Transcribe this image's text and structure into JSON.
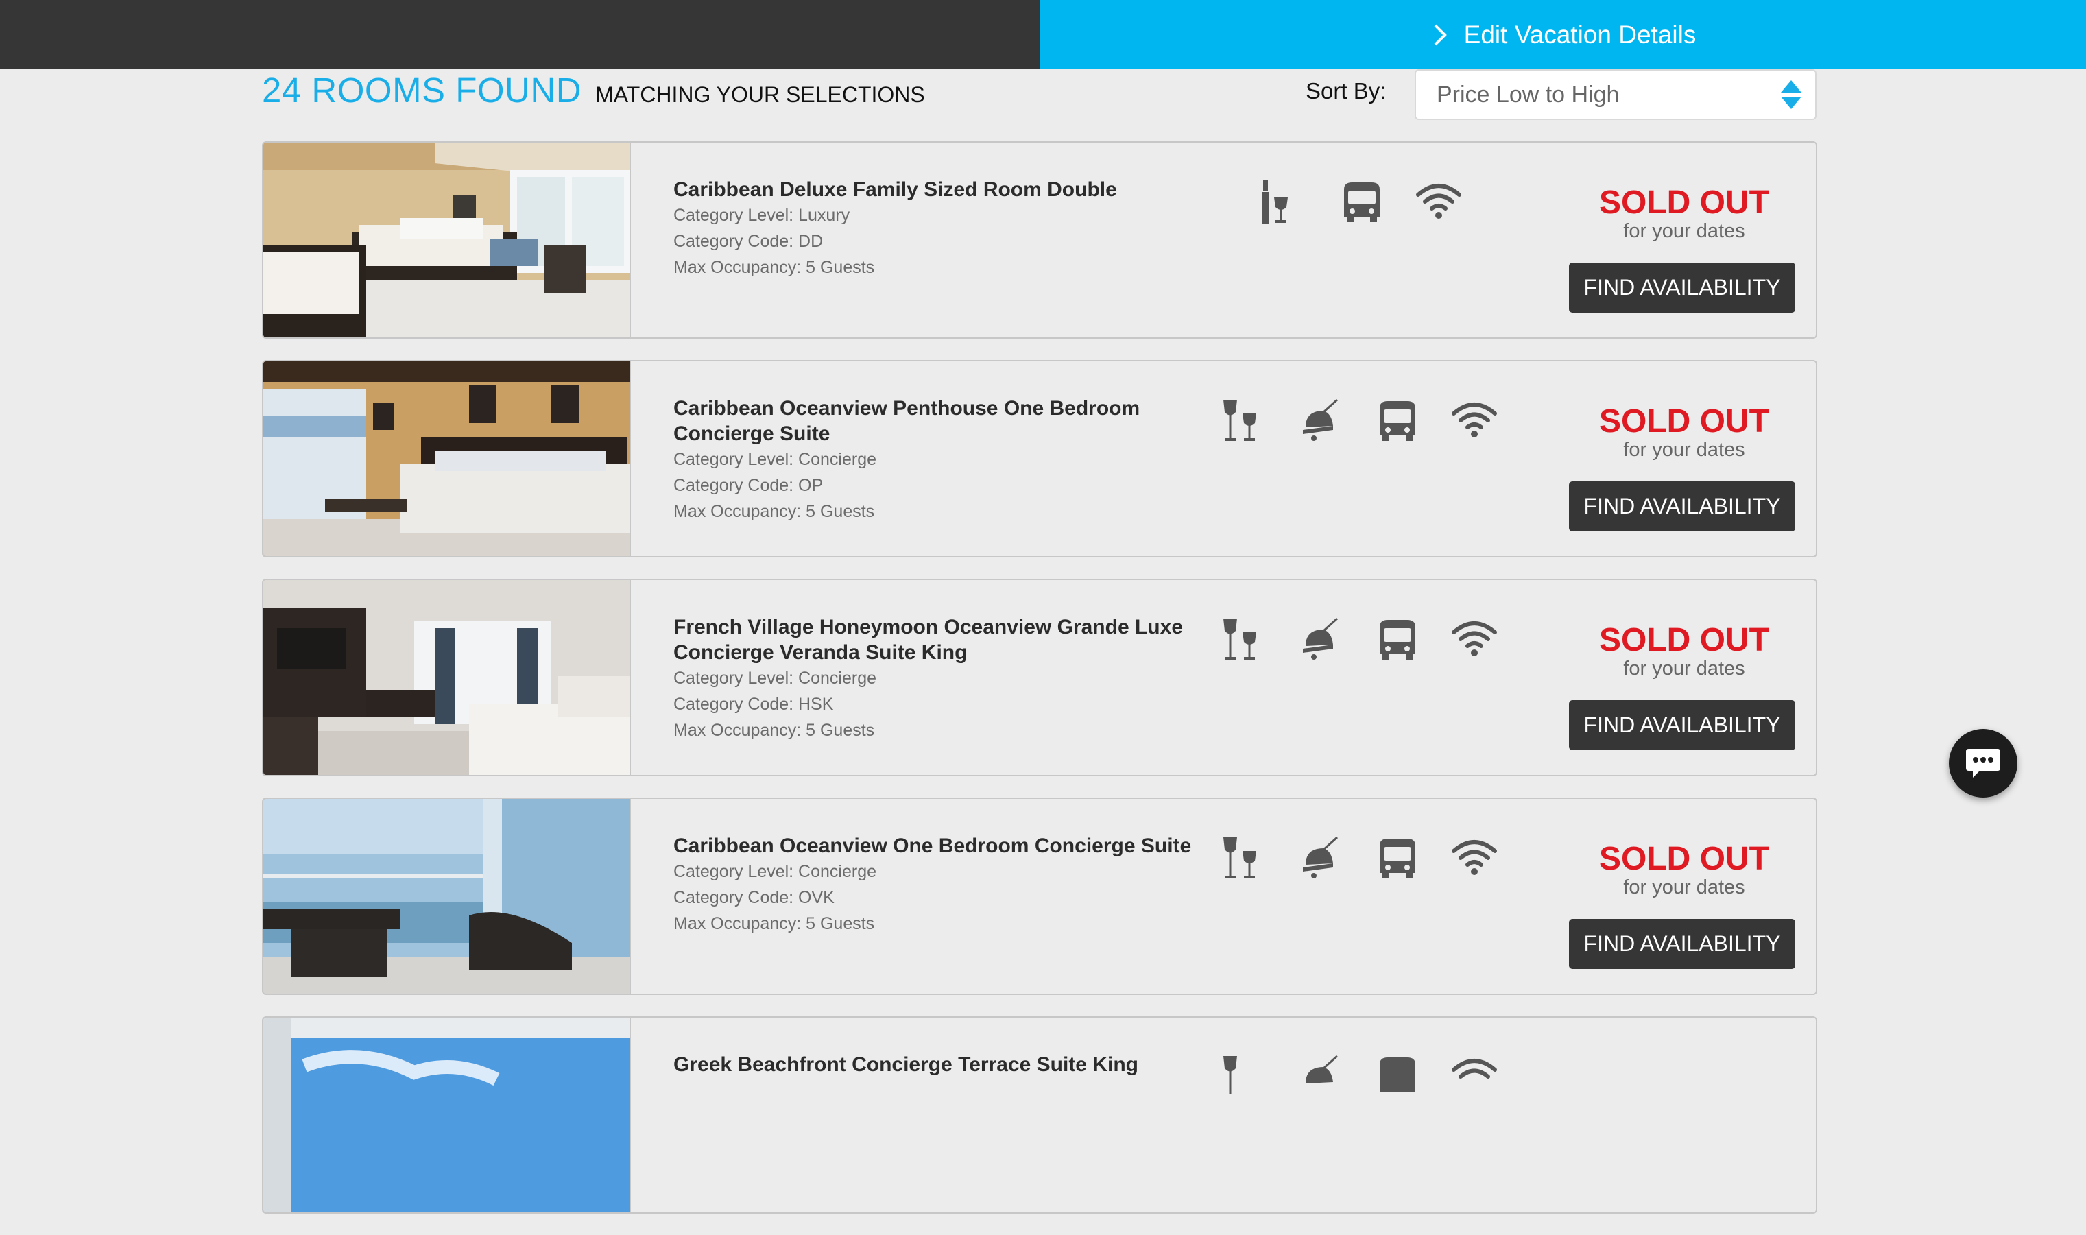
{
  "header": {
    "edit_label": "Edit Vacation Details"
  },
  "results": {
    "count_text": "24 ROOMS FOUND",
    "matching_text": "MATCHING YOUR SELECTIONS"
  },
  "sort": {
    "label": "Sort By:",
    "selected": "Price Low to High"
  },
  "rooms": [
    {
      "name": "Caribbean Deluxe Family Sized Room Double",
      "category_level": "Category Level: Luxury",
      "category_code": "Category Code: DD",
      "max_occupancy": "Max Occupancy: 5 Guests",
      "amenities": [
        "wine-bottle-icon",
        "shuttle-bus-icon",
        "wifi-icon"
      ],
      "status": "SOLD OUT",
      "status_sub": "for your dates",
      "button": "FIND AVAILABILITY"
    },
    {
      "name": "Caribbean Oceanview Penthouse One Bedroom Concierge Suite",
      "category_level": "Category Level: Concierge",
      "category_code": "Category Code: OP",
      "max_occupancy": "Max Occupancy: 5 Guests",
      "amenities": [
        "wine-glasses-icon",
        "concierge-bell-icon",
        "shuttle-bus-icon",
        "wifi-icon"
      ],
      "status": "SOLD OUT",
      "status_sub": "for your dates",
      "button": "FIND AVAILABILITY"
    },
    {
      "name": "French Village Honeymoon Oceanview Grande Luxe Concierge Veranda Suite King",
      "category_level": "Category Level: Concierge",
      "category_code": "Category Code: HSK",
      "max_occupancy": "Max Occupancy: 5 Guests",
      "amenities": [
        "wine-glasses-icon",
        "concierge-bell-icon",
        "shuttle-bus-icon",
        "wifi-icon"
      ],
      "status": "SOLD OUT",
      "status_sub": "for your dates",
      "button": "FIND AVAILABILITY"
    },
    {
      "name": "Caribbean Oceanview One Bedroom Concierge Suite",
      "category_level": "Category Level: Concierge",
      "category_code": "Category Code: OVK",
      "max_occupancy": "Max Occupancy: 5 Guests",
      "amenities": [
        "wine-glasses-icon",
        "concierge-bell-icon",
        "shuttle-bus-icon",
        "wifi-icon"
      ],
      "status": "SOLD OUT",
      "status_sub": "for your dates",
      "button": "FIND AVAILABILITY"
    },
    {
      "name": "Greek Beachfront Concierge Terrace Suite King",
      "amenities": [
        "wine-glasses-icon",
        "concierge-bell-icon",
        "shuttle-bus-icon",
        "wifi-icon"
      ]
    }
  ],
  "colors": {
    "accent": "#00b6f0",
    "sold_out": "#e01a22",
    "dark": "#363636"
  }
}
